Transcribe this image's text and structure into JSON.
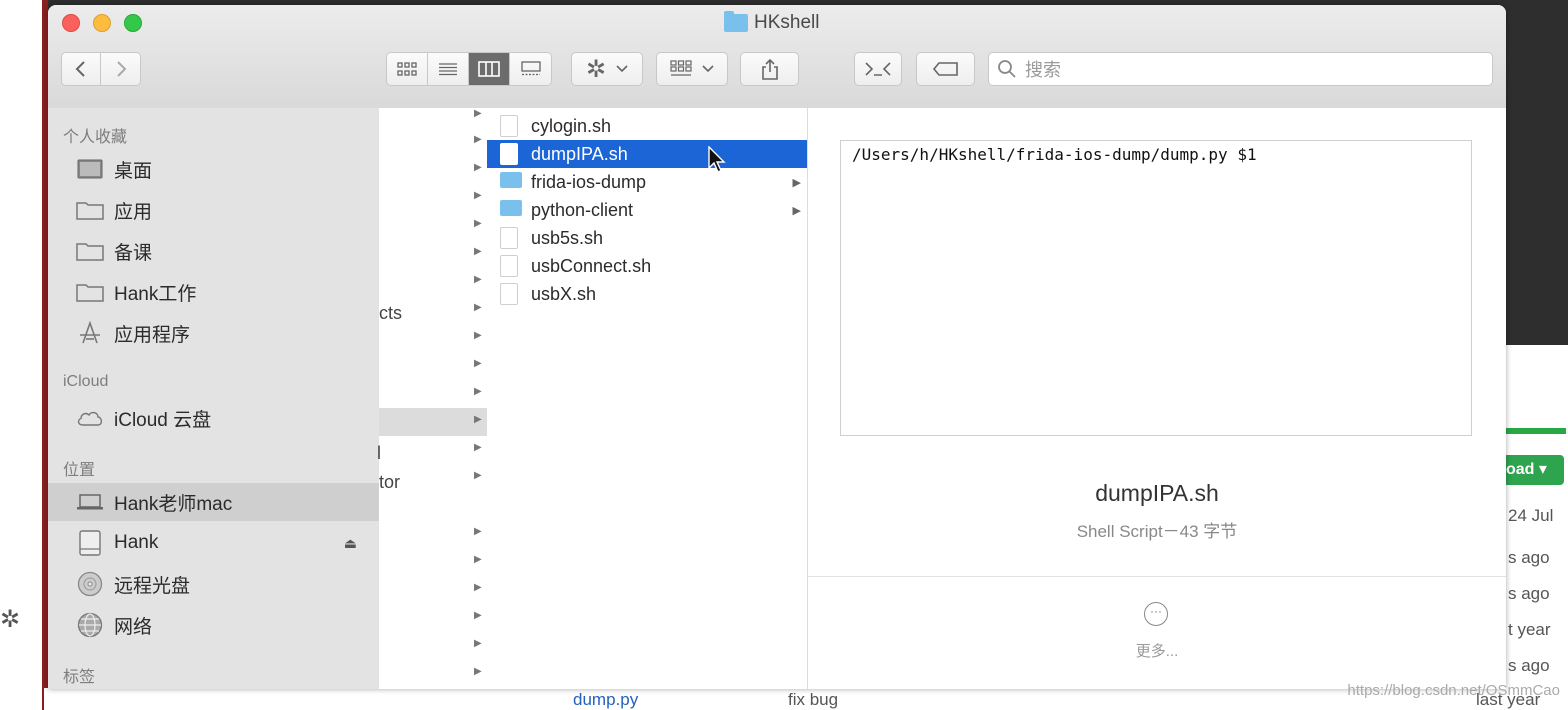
{
  "background": {
    "right_texts": [
      "oad ▾",
      "24 Jul",
      "s ago",
      "s ago",
      "t year",
      "s ago",
      "last year"
    ],
    "bottom_file": "dump.py",
    "bottom_commit": "fix bug",
    "watermark": "https://blog.csdn.net/OSmmCao"
  },
  "window": {
    "title": "HKshell",
    "icons": [
      "close-light",
      "minimize-light",
      "zoom-light"
    ]
  },
  "toolbar": {
    "back_icon": "chevron-left-icon",
    "forward_icon": "chevron-right-icon",
    "view_icons": [
      "icon-view",
      "list-view",
      "column-view",
      "gallery-view"
    ],
    "active_view": "column-view",
    "action_icon": "gear-icon",
    "group_icon": "group-icon",
    "share_icon": "share-icon",
    "terminal_icon": "terminal-icon",
    "tag_icon": "tag-icon",
    "search_placeholder": "搜索"
  },
  "sidebar": {
    "favorites_header": "个人收藏",
    "favorites": [
      {
        "label": "桌面",
        "icon": "desktop-icon"
      },
      {
        "label": "应用",
        "icon": "folder-icon"
      },
      {
        "label": "备课",
        "icon": "folder-icon"
      },
      {
        "label": "Hank工作",
        "icon": "folder-icon"
      },
      {
        "label": "应用程序",
        "icon": "applications-icon"
      }
    ],
    "icloud_header": "iCloud",
    "icloud": [
      {
        "label": "iCloud 云盘",
        "icon": "cloud-icon"
      }
    ],
    "locations_header": "位置",
    "locations": [
      {
        "label": "Hank老师mac",
        "icon": "laptop-icon",
        "selected": true
      },
      {
        "label": "Hank",
        "icon": "disk-icon",
        "eject": "⏏"
      },
      {
        "label": "远程光盘",
        "icon": "optical-disc-icon"
      },
      {
        "label": "网络",
        "icon": "network-icon"
      }
    ],
    "tags_header": "标签"
  },
  "column1": {
    "fragments": [
      "cts",
      "tor",
      "l"
    ]
  },
  "column2": {
    "files": [
      {
        "name": "cylogin.sh",
        "type": "doc"
      },
      {
        "name": "dumpIPA.sh",
        "type": "doc",
        "selected": true
      },
      {
        "name": "frida-ios-dump",
        "type": "folder"
      },
      {
        "name": "python-client",
        "type": "folder"
      },
      {
        "name": "usb5s.sh",
        "type": "doc"
      },
      {
        "name": "usbConnect.sh",
        "type": "doc"
      },
      {
        "name": "usbX.sh",
        "type": "doc"
      }
    ]
  },
  "preview": {
    "content": "/Users/h/HKshell/frida-ios-dump/dump.py $1",
    "filename": "dumpIPA.sh",
    "meta": "Shell Script－43 字节",
    "more_label": "更多..."
  }
}
